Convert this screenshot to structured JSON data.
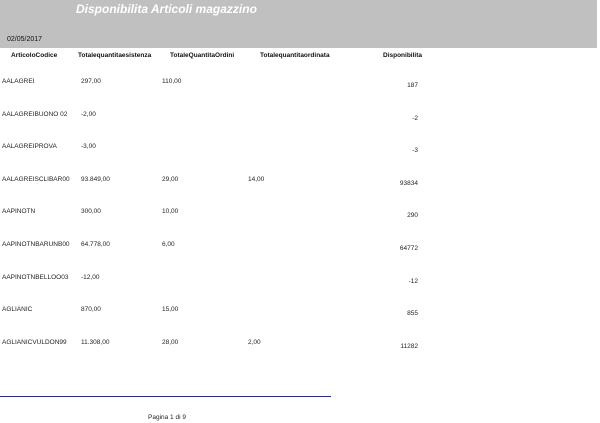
{
  "header": {
    "title": "Disponibilita Articoli magazzino",
    "date": "02/05/2017"
  },
  "columns": [
    "ArticoloCodice",
    "Totalequantitaesistenza",
    "TotaleQuantitaOrdini",
    "Totalequantitaordinata",
    "Disponibilita"
  ],
  "rows": [
    {
      "codice": "AALAGREI",
      "esistenza": "297,00",
      "ordini": "110,00",
      "ordinata": "",
      "disponibilita": "187"
    },
    {
      "codice": "AALAGREIBUONO 02",
      "esistenza": "-2,00",
      "ordini": "",
      "ordinata": "",
      "disponibilita": "-2"
    },
    {
      "codice": "AALAGREIPROVA",
      "esistenza": "-3,00",
      "ordini": "",
      "ordinata": "",
      "disponibilita": "-3"
    },
    {
      "codice": "AALAGREISCLIBAR00",
      "esistenza": "93.849,00",
      "ordini": "29,00",
      "ordinata": "14,00",
      "disponibilita": "93834"
    },
    {
      "codice": "AAPINOTN",
      "esistenza": "300,00",
      "ordini": "10,00",
      "ordinata": "",
      "disponibilita": "290"
    },
    {
      "codice": "AAPINOTNBARUNB00",
      "esistenza": "64.778,00",
      "ordini": "6,00",
      "ordinata": "",
      "disponibilita": "64772"
    },
    {
      "codice": "AAPINOTNBELLOO03",
      "esistenza": "-12,00",
      "ordini": "",
      "ordinata": "",
      "disponibilita": "-12"
    },
    {
      "codice": "AGLIANIC",
      "esistenza": "870,00",
      "ordini": "15,00",
      "ordinata": "",
      "disponibilita": "855"
    },
    {
      "codice": "AGLIANICVULDON99",
      "esistenza": "11.308,00",
      "ordini": "28,00",
      "ordinata": "2,00",
      "disponibilita": "11282"
    }
  ],
  "footer": {
    "page_label": "Pagina 1 di 9"
  }
}
